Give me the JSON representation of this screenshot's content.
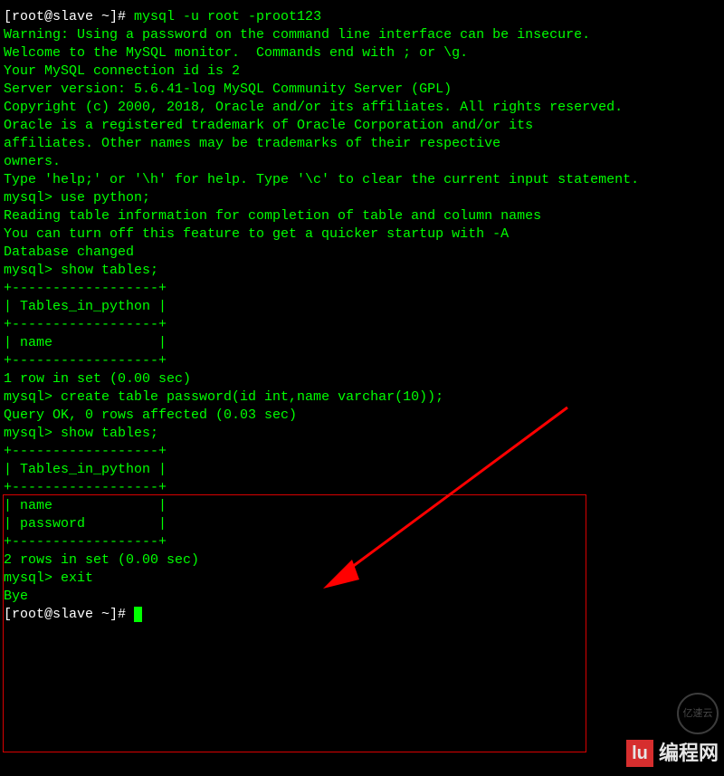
{
  "lines": [
    {
      "segments": [
        {
          "t": "[root@slave ~]# ",
          "c": "white"
        },
        {
          "t": "mysql -u root -proot123",
          "c": "green"
        }
      ]
    },
    {
      "segments": [
        {
          "t": "Warning: Using a password on the command line interface can be insecure.",
          "c": "green"
        }
      ]
    },
    {
      "segments": [
        {
          "t": "Welcome to the MySQL monitor.  Commands end with ; or \\g.",
          "c": "green"
        }
      ]
    },
    {
      "segments": [
        {
          "t": "Your MySQL connection id is 2",
          "c": "green"
        }
      ]
    },
    {
      "segments": [
        {
          "t": "Server version: 5.6.41-log MySQL Community Server (GPL)",
          "c": "green"
        }
      ]
    },
    {
      "segments": [
        {
          "t": "",
          "c": "green"
        }
      ]
    },
    {
      "segments": [
        {
          "t": "Copyright (c) 2000, 2018, Oracle and/or its affiliates. All rights reserved.",
          "c": "green"
        }
      ]
    },
    {
      "segments": [
        {
          "t": "",
          "c": "green"
        }
      ]
    },
    {
      "segments": [
        {
          "t": "Oracle is a registered trademark of Oracle Corporation and/or its",
          "c": "green"
        }
      ]
    },
    {
      "segments": [
        {
          "t": "affiliates. Other names may be trademarks of their respective",
          "c": "green"
        }
      ]
    },
    {
      "segments": [
        {
          "t": "owners.",
          "c": "green"
        }
      ]
    },
    {
      "segments": [
        {
          "t": "",
          "c": "green"
        }
      ]
    },
    {
      "segments": [
        {
          "t": "Type 'help;' or '\\h' for help. Type '\\c' to clear the current input statement.",
          "c": "green"
        }
      ]
    },
    {
      "segments": [
        {
          "t": "",
          "c": "green"
        }
      ]
    },
    {
      "segments": [
        {
          "t": "mysql> ",
          "c": "green"
        },
        {
          "t": "use python;",
          "c": "green"
        }
      ]
    },
    {
      "segments": [
        {
          "t": "Reading table information for completion of table and column names",
          "c": "green"
        }
      ]
    },
    {
      "segments": [
        {
          "t": "You can turn off this feature to get a quicker startup with -A",
          "c": "green"
        }
      ]
    },
    {
      "segments": [
        {
          "t": "",
          "c": "green"
        }
      ]
    },
    {
      "segments": [
        {
          "t": "Database changed",
          "c": "green"
        }
      ]
    },
    {
      "segments": [
        {
          "t": "mysql> ",
          "c": "green"
        },
        {
          "t": "show tables;",
          "c": "green"
        }
      ]
    },
    {
      "segments": [
        {
          "t": "+------------------+",
          "c": "green"
        }
      ]
    },
    {
      "segments": [
        {
          "t": "| Tables_in_python |",
          "c": "green"
        }
      ]
    },
    {
      "segments": [
        {
          "t": "+------------------+",
          "c": "green"
        }
      ]
    },
    {
      "segments": [
        {
          "t": "| name             |",
          "c": "green"
        }
      ]
    },
    {
      "segments": [
        {
          "t": "+------------------+",
          "c": "green"
        }
      ]
    },
    {
      "segments": [
        {
          "t": "1 row in set (0.00 sec)",
          "c": "green"
        }
      ]
    },
    {
      "segments": [
        {
          "t": "",
          "c": "green"
        }
      ]
    },
    {
      "segments": [
        {
          "t": "mysql> ",
          "c": "green"
        },
        {
          "t": "create table password(id int,name varchar(10));",
          "c": "green"
        }
      ]
    },
    {
      "segments": [
        {
          "t": "Query OK, 0 rows affected (0.03 sec)",
          "c": "green"
        }
      ]
    },
    {
      "segments": [
        {
          "t": "",
          "c": "green"
        }
      ]
    },
    {
      "segments": [
        {
          "t": "mysql> ",
          "c": "green"
        },
        {
          "t": "show tables;",
          "c": "green"
        }
      ]
    },
    {
      "segments": [
        {
          "t": "+------------------+",
          "c": "green"
        }
      ]
    },
    {
      "segments": [
        {
          "t": "| Tables_in_python |",
          "c": "green"
        }
      ]
    },
    {
      "segments": [
        {
          "t": "+------------------+",
          "c": "green"
        }
      ]
    },
    {
      "segments": [
        {
          "t": "| name             |",
          "c": "green"
        }
      ]
    },
    {
      "segments": [
        {
          "t": "| password         |",
          "c": "green"
        }
      ]
    },
    {
      "segments": [
        {
          "t": "+------------------+",
          "c": "green"
        }
      ]
    },
    {
      "segments": [
        {
          "t": "2 rows in set (0.00 sec)",
          "c": "green"
        }
      ]
    },
    {
      "segments": [
        {
          "t": "",
          "c": "green"
        }
      ]
    },
    {
      "segments": [
        {
          "t": "mysql> ",
          "c": "green"
        },
        {
          "t": "exit",
          "c": "green"
        }
      ]
    },
    {
      "segments": [
        {
          "t": "Bye",
          "c": "green"
        }
      ]
    },
    {
      "segments": [
        {
          "t": "[root@slave ~]# ",
          "c": "white"
        }
      ],
      "cursor": true
    }
  ],
  "watermark": {
    "text": "编程网",
    "badge": "亿速云",
    "icon": "lu"
  }
}
